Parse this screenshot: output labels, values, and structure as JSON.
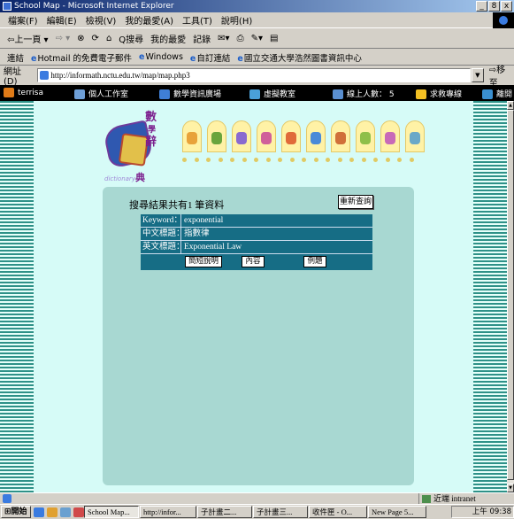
{
  "window": {
    "title": "School Map - Microsoft Internet Explorer",
    "buttons": [
      "_",
      "8",
      "x"
    ]
  },
  "menu": [
    "檔案(F)",
    "編輯(E)",
    "檢視(V)",
    "我的最愛(A)",
    "工具(T)",
    "說明(H)"
  ],
  "toolbar": {
    "back": "⇦上一頁 ▾",
    "forward": "⇨ ▾",
    "stop": "⊗",
    "refresh": "⟳",
    "home": "⌂",
    "search": "Q搜尋",
    "favorites": "我的最愛",
    "history": "記錄",
    "mail": "✉▾",
    "print": "⎙",
    "edit": "✎▾",
    "discuss": "▤"
  },
  "links": {
    "label": "連結",
    "items": [
      "Hotmail 的免費電子郵件",
      "Windows",
      "自訂連結",
      "國立交通大學浩然圖書資訊中心"
    ]
  },
  "address": {
    "label": "網址(D)",
    "url": "http://informath.nctu.edu.tw/map/map.php3",
    "go": "移至"
  },
  "sitenav": {
    "items": [
      {
        "label": "terrisa",
        "color": "#e07b18"
      },
      {
        "label": "個人工作室",
        "color": "#6fa0d8"
      },
      {
        "label": "數學資訊廣場",
        "color": "#3f7fd6"
      },
      {
        "label": "虛擬教室",
        "color": "#4aa0d8"
      },
      {
        "label": "線上人數： 5",
        "color": "#5a8fd0"
      },
      {
        "label": "求救專線",
        "color": "#f3c023"
      },
      {
        "label": "離開",
        "color": "#3a8fd0"
      }
    ]
  },
  "logo": {
    "chars": [
      "數",
      "學",
      "辭",
      "典"
    ],
    "subtitle": "dictionary"
  },
  "icons": [
    {
      "name": "bell-icon",
      "color": "#e8a23a"
    },
    {
      "name": "tree-icon",
      "color": "#6aa53c"
    },
    {
      "name": "tools-icon",
      "color": "#8a6ad0"
    },
    {
      "name": "globe-icon",
      "color": "#d0609a"
    },
    {
      "name": "books-icon",
      "color": "#e06a3a"
    },
    {
      "name": "tube-icon",
      "color": "#4a8ad8"
    },
    {
      "name": "reading-icon",
      "color": "#d0703a"
    },
    {
      "name": "building-icon",
      "color": "#8fbf4a"
    },
    {
      "name": "people-icon",
      "color": "#c86ab8"
    },
    {
      "name": "flask-icon",
      "color": "#6aa8c8"
    }
  ],
  "result": {
    "summary": "搜尋結果共有1 筆資料",
    "reset_label": "重新查詢",
    "rows": [
      {
        "label": "Keyword：",
        "value": "exponential"
      },
      {
        "label": "中文標題：",
        "value": "指數律"
      },
      {
        "label": "英文標題：",
        "value": "Exponential Law"
      }
    ],
    "actions": [
      "簡短說明",
      "內容",
      "例題"
    ]
  },
  "status": {
    "left": "",
    "zone": "近端 intranet"
  },
  "taskbar": {
    "start": "開始",
    "tasks": [
      {
        "label": "School Map...",
        "active": true
      },
      {
        "label": "http://infor...",
        "active": false
      },
      {
        "label": "子計畫二...",
        "active": false
      },
      {
        "label": "子計畫三...",
        "active": false
      },
      {
        "label": "收件匣 - O...",
        "active": false
      },
      {
        "label": "New Page 5...",
        "active": false
      }
    ],
    "clock": "上午 09:38"
  }
}
